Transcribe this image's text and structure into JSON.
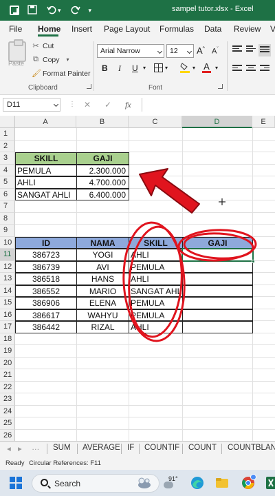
{
  "window": {
    "title": "sampel tutor.xlsx  -  Excel"
  },
  "menu": {
    "tabs": [
      "File",
      "Home",
      "Insert",
      "Page Layout",
      "Formulas",
      "Data",
      "Review",
      "V"
    ],
    "active": "Home"
  },
  "ribbon": {
    "clipboard": {
      "paste_label": "Paste",
      "cut_label": "Cut",
      "copy_label": "Copy",
      "format_painter_label": "Format Painter",
      "group_label": "Clipboard"
    },
    "font": {
      "font_name": "Arial Narrow",
      "font_size": "12",
      "grow_label": "A",
      "shrink_label": "A",
      "bold_label": "B",
      "italic_label": "I",
      "underline_label": "U",
      "color_label": "A",
      "group_label": "Font",
      "font_color": "#e02020",
      "fill_color": "#ffd700"
    }
  },
  "formula_bar": {
    "name_box": "D11",
    "fx_label": "fx",
    "cancel_label": "✕",
    "enter_label": "✓",
    "content": ""
  },
  "grid": {
    "columns": [
      "A",
      "B",
      "C",
      "D",
      "E"
    ],
    "selected_column": "D",
    "rows": [
      "1",
      "2",
      "3",
      "4",
      "5",
      "6",
      "7",
      "8",
      "9",
      "10",
      "11",
      "12",
      "13",
      "14",
      "15",
      "16",
      "17",
      "18",
      "19",
      "20",
      "21",
      "22",
      "23",
      "24",
      "25",
      "26"
    ],
    "selected_row": "11",
    "table1": {
      "headers": [
        "SKILL",
        "GAJI"
      ],
      "rows": [
        [
          "PEMULA",
          "2.300.000"
        ],
        [
          "AHLI",
          "4.700.000"
        ],
        [
          "SANGAT AHLI",
          "6.400.000"
        ]
      ]
    },
    "table2": {
      "headers": [
        "ID",
        "NAMA",
        "SKILL",
        "GAJI"
      ],
      "rows": [
        [
          "386723",
          "YOGI",
          "AHLI",
          ""
        ],
        [
          "386739",
          "AVI",
          "PEMULA",
          ""
        ],
        [
          "386518",
          "HANS",
          "AHLI",
          ""
        ],
        [
          "386552",
          "MARIO",
          "SANGAT AHLI",
          ""
        ],
        [
          "386906",
          "ELENA",
          "PEMULA",
          ""
        ],
        [
          "386617",
          "WAHYU",
          "PEMULA",
          ""
        ],
        [
          "386442",
          "RIZAL",
          "AHLI",
          ""
        ]
      ]
    },
    "active_cell": "D11"
  },
  "annotations": {
    "color": "#e0141e"
  },
  "sheet_tabs": [
    "SUM",
    "AVERAGE",
    "IF",
    "COUNTIF",
    "COUNT",
    "COUNTBLANK"
  ],
  "status": {
    "ready": "Ready",
    "circular": "Circular References: F11"
  },
  "taskbar": {
    "search_label": "Search",
    "weather_temp": "91°"
  }
}
